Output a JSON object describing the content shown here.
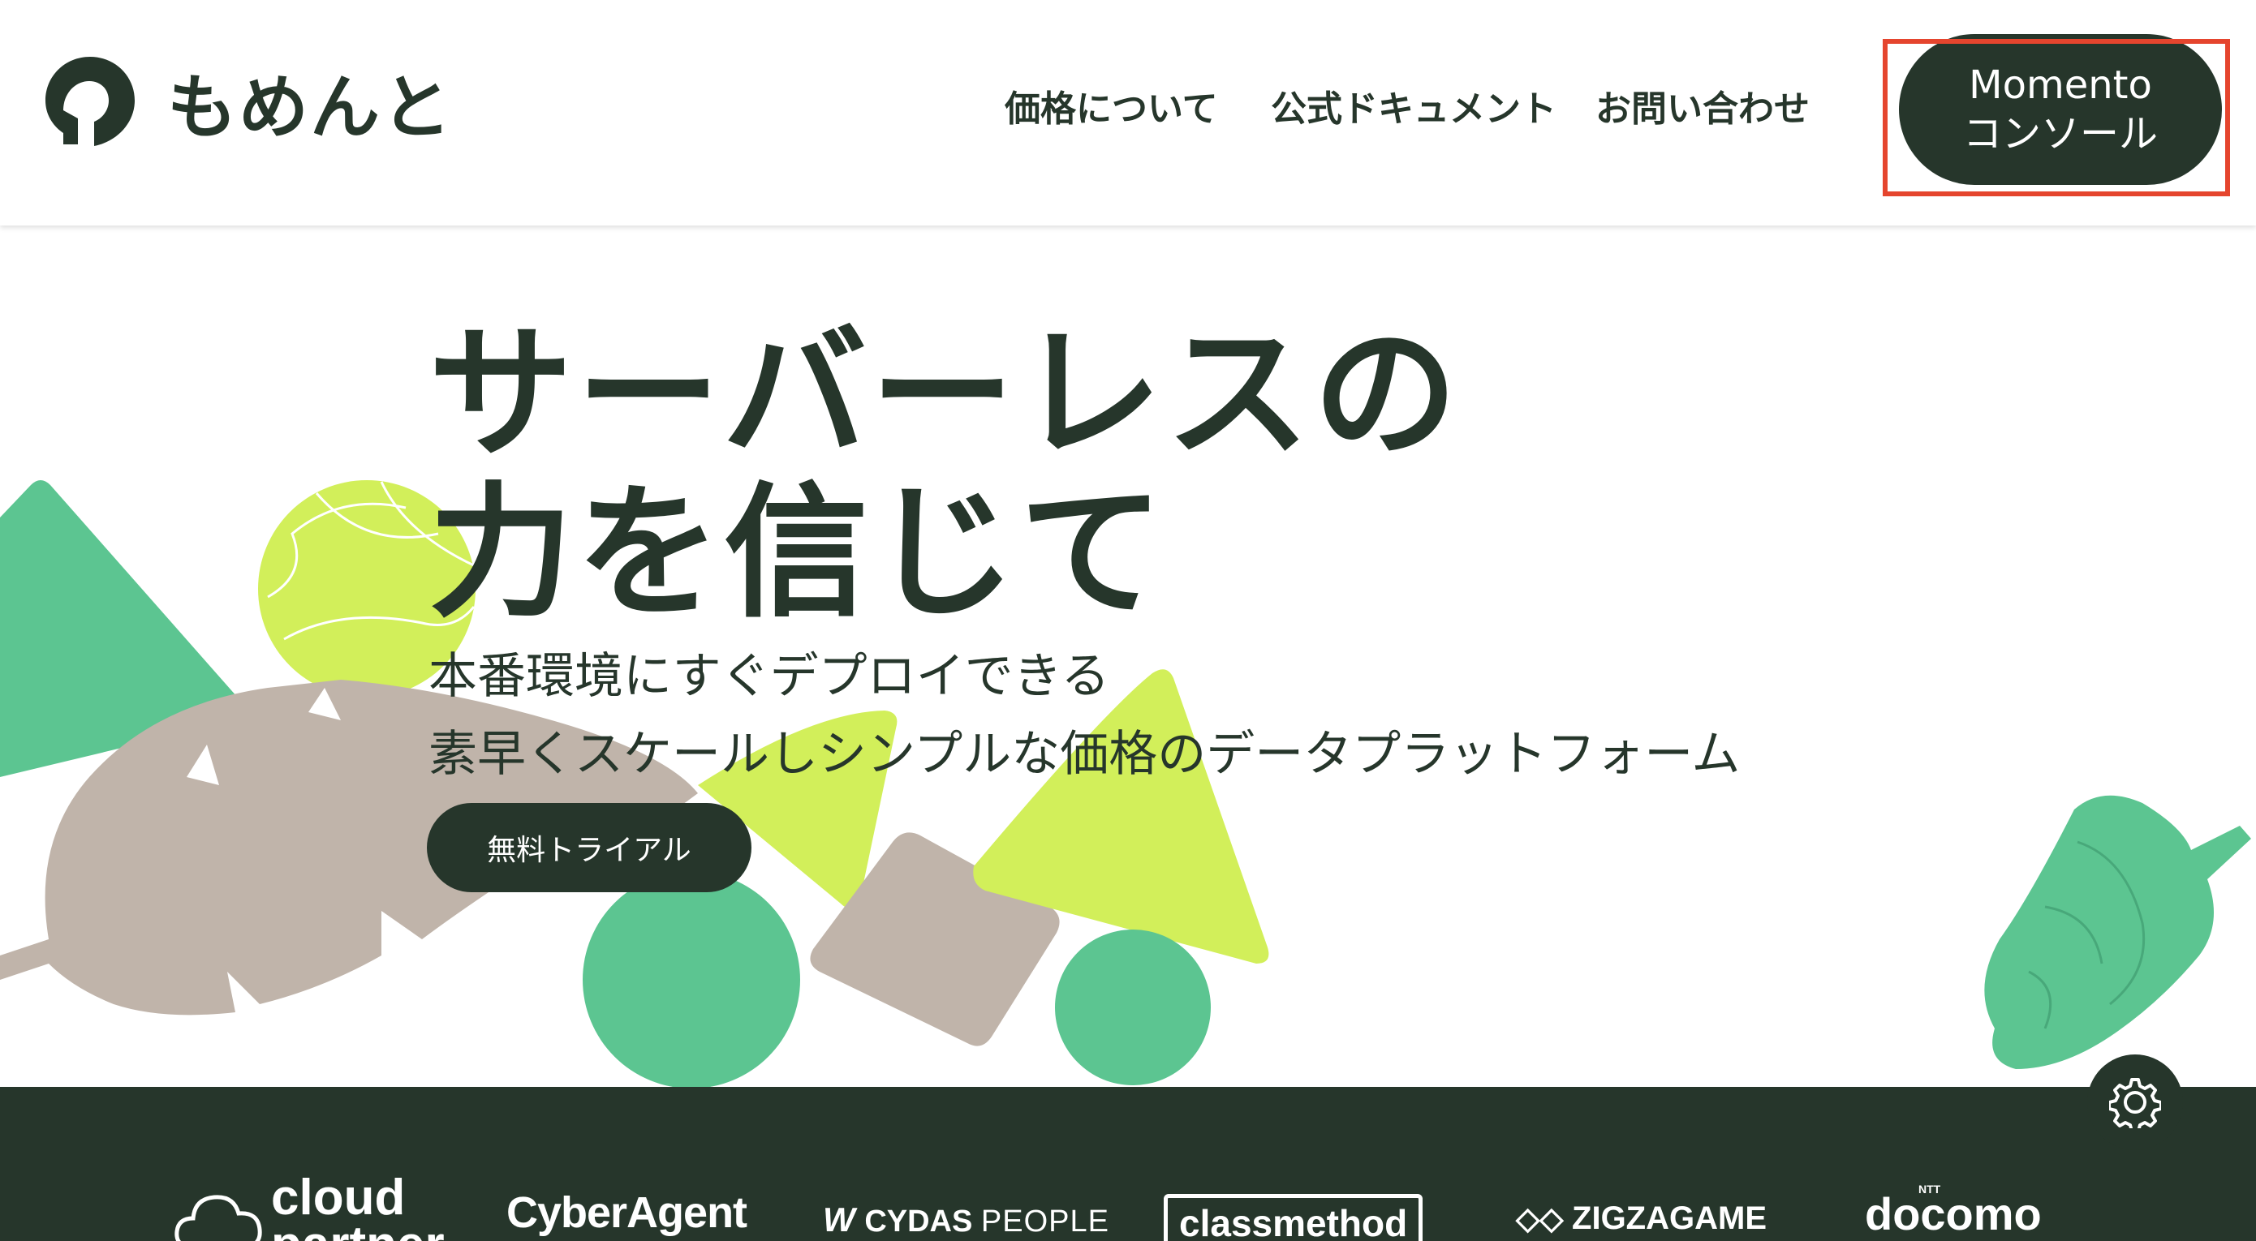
{
  "brand": {
    "name": "もめんと",
    "logo_icon": "bird-head-icon",
    "dark": "#26362b"
  },
  "nav": {
    "pricing": "価格について",
    "docs": "公式ドキュメント",
    "contact": "お問い合わせ",
    "console_line1": "Momento",
    "console_line2": "コンソール"
  },
  "hero": {
    "title_line1": "サーバーレスの",
    "title_line2": "力を信じて",
    "subtitle_line1": "本番環境にすぐデプロイできる",
    "subtitle_line2": "素早くスケールしシンプルな価格のデータプラットフォーム",
    "cta": "無料トライアル"
  },
  "partners": [
    {
      "line1": "cloud",
      "line2": "partner"
    },
    {
      "name": "CyberAgent"
    },
    {
      "name_bold": "CYDAS",
      "name_light": "PEOPLE"
    },
    {
      "name": "classmethod"
    },
    {
      "name": "ZIGZAGAME"
    },
    {
      "sup": "NTT",
      "name": "docomo"
    }
  ],
  "colors": {
    "green": "#5cc591",
    "lime": "#d2ef5a",
    "taupe": "#c0b4aa",
    "highlight": "#e5452e"
  },
  "settings_icon": "gear-icon"
}
